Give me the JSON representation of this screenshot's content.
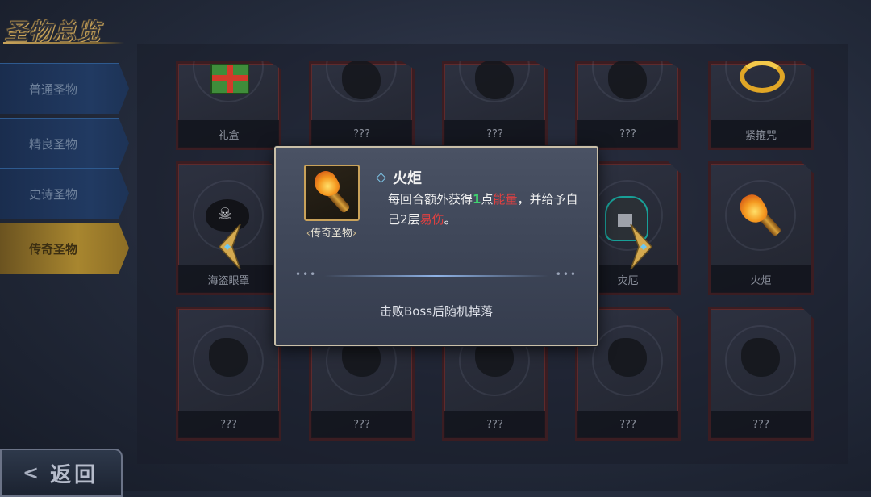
{
  "screen_title": "圣物总览",
  "tabs": [
    {
      "label": "普通圣物",
      "active": false
    },
    {
      "label": "精良圣物",
      "active": false
    },
    {
      "label": "史诗圣物",
      "active": false
    },
    {
      "label": "传奇圣物",
      "active": true
    }
  ],
  "grid": {
    "row1": [
      "礼盒",
      "???",
      "???",
      "???",
      "紧箍咒"
    ],
    "row2": [
      "海盗眼罩",
      "",
      "",
      "灾厄",
      "火炬"
    ],
    "row3": [
      "???",
      "???",
      "???",
      "???",
      "???"
    ]
  },
  "popup": {
    "item_name": "火炬",
    "rarity": "传奇圣物",
    "desc_prefix": "每回合额外获得",
    "desc_number": "1",
    "desc_mid1": "点",
    "desc_keyword1": "能量",
    "desc_mid2": "，并给予自己",
    "desc_number2": "2",
    "desc_mid3": "层",
    "desc_keyword2": "易伤",
    "desc_suffix": "。",
    "source": "击败Boss后随机掉落",
    "dots": "•••"
  },
  "back_button": {
    "arrow": "<",
    "label": "返回"
  },
  "colors": {
    "accent_gold": "#c9a45a",
    "keyword_red": "#e34040",
    "number_green": "#3fd36f",
    "tab_blue": "#213a62",
    "card_border": "#3b1d22"
  },
  "icons": {
    "nav_left": "chevron-left-icon",
    "nav_right": "chevron-right-icon",
    "back": "chevron-left-icon"
  }
}
